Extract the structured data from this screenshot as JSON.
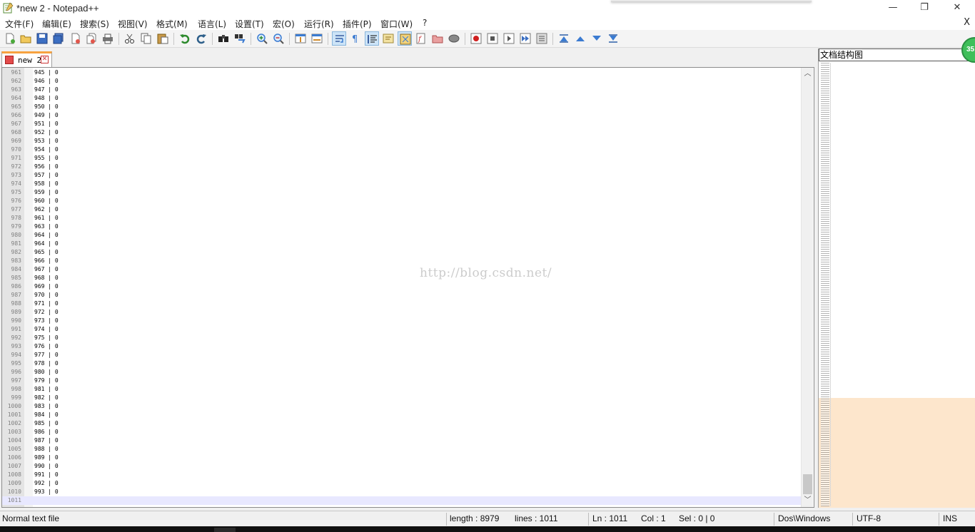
{
  "window": {
    "title": "*new 2 - Notepad++",
    "minimize_glyph": "—",
    "restore_glyph": "❐",
    "close_glyph": "✕"
  },
  "menu": {
    "items": [
      "文件(F)",
      "编辑(E)",
      "搜索(S)",
      "视图(V)",
      "格式(M)",
      "语言(L)",
      "设置(T)",
      "宏(O)",
      "运行(R)",
      "插件(P)",
      "窗口(W)",
      "?"
    ],
    "close_label": "X"
  },
  "toolbar": {
    "icons": [
      "new-file-icon",
      "open-file-icon",
      "save-icon",
      "save-all-icon",
      "close-icon",
      "close-all-icon",
      "print-icon",
      "cut-icon",
      "copy-icon",
      "paste-icon",
      "undo-icon",
      "redo-icon",
      "find-icon",
      "replace-icon",
      "zoom-in-icon",
      "zoom-out-icon",
      "sync-vertical-icon",
      "sync-horizontal-icon",
      "word-wrap-icon",
      "show-all-chars-icon",
      "indent-guide-icon",
      "user-language-icon",
      "document-map-icon",
      "function-list-icon",
      "folder-workspace-icon",
      "monitoring-icon",
      "record-macro-icon",
      "stop-macro-icon",
      "play-macro-icon",
      "run-macro-multiple-icon",
      "save-macro-icon",
      "first-icon",
      "previous-icon",
      "next-icon",
      "last-icon"
    ],
    "active": [
      "word-wrap-icon",
      "indent-guide-icon",
      "document-map-icon"
    ]
  },
  "tab": {
    "label": "new 2",
    "close_glyph": "✕"
  },
  "editor": {
    "lines": [
      {
        "n": "961",
        "text": "945 | 0"
      },
      {
        "n": "962",
        "text": "946 | 0"
      },
      {
        "n": "963",
        "text": "947 | 0"
      },
      {
        "n": "964",
        "text": "948 | 0"
      },
      {
        "n": "965",
        "text": "950 | 0"
      },
      {
        "n": "966",
        "text": "949 | 0"
      },
      {
        "n": "967",
        "text": "951 | 0"
      },
      {
        "n": "968",
        "text": "952 | 0"
      },
      {
        "n": "969",
        "text": "953 | 0"
      },
      {
        "n": "970",
        "text": "954 | 0"
      },
      {
        "n": "971",
        "text": "955 | 0"
      },
      {
        "n": "972",
        "text": "956 | 0"
      },
      {
        "n": "973",
        "text": "957 | 0"
      },
      {
        "n": "974",
        "text": "958 | 0"
      },
      {
        "n": "975",
        "text": "959 | 0"
      },
      {
        "n": "976",
        "text": "960 | 0"
      },
      {
        "n": "977",
        "text": "962 | 0"
      },
      {
        "n": "978",
        "text": "961 | 0"
      },
      {
        "n": "979",
        "text": "963 | 0"
      },
      {
        "n": "980",
        "text": "964 | 0"
      },
      {
        "n": "981",
        "text": "964 | 0"
      },
      {
        "n": "982",
        "text": "965 | 0"
      },
      {
        "n": "983",
        "text": "966 | 0"
      },
      {
        "n": "984",
        "text": "967 | 0"
      },
      {
        "n": "985",
        "text": "968 | 0"
      },
      {
        "n": "986",
        "text": "969 | 0"
      },
      {
        "n": "987",
        "text": "970 | 0"
      },
      {
        "n": "988",
        "text": "971 | 0"
      },
      {
        "n": "989",
        "text": "972 | 0"
      },
      {
        "n": "990",
        "text": "973 | 0"
      },
      {
        "n": "991",
        "text": "974 | 0"
      },
      {
        "n": "992",
        "text": "975 | 0"
      },
      {
        "n": "993",
        "text": "976 | 0"
      },
      {
        "n": "994",
        "text": "977 | 0"
      },
      {
        "n": "995",
        "text": "978 | 0"
      },
      {
        "n": "996",
        "text": "980 | 0"
      },
      {
        "n": "997",
        "text": "979 | 0"
      },
      {
        "n": "998",
        "text": "981 | 0"
      },
      {
        "n": "999",
        "text": "982 | 0"
      },
      {
        "n": "1000",
        "text": "983 | 0"
      },
      {
        "n": "1001",
        "text": "984 | 0"
      },
      {
        "n": "1002",
        "text": "985 | 0"
      },
      {
        "n": "1003",
        "text": "986 | 0"
      },
      {
        "n": "1004",
        "text": "987 | 0"
      },
      {
        "n": "1005",
        "text": "988 | 0"
      },
      {
        "n": "1006",
        "text": "989 | 0"
      },
      {
        "n": "1007",
        "text": "990 | 0"
      },
      {
        "n": "1008",
        "text": "991 | 0"
      },
      {
        "n": "1009",
        "text": "992 | 0"
      },
      {
        "n": "1010",
        "text": "993 | 0"
      },
      {
        "n": "1011",
        "text": ""
      }
    ],
    "current_line": "1011",
    "watermark": "http://blog.csdn.net/",
    "scroll_up_glyph": "︿",
    "scroll_down_glyph": "﹀"
  },
  "doc_map": {
    "title": "文档结构图",
    "badge": "35"
  },
  "status": {
    "file_type": "Normal text file",
    "length": "length : 8979",
    "lines": "lines : 1011",
    "ln": "Ln : 1011",
    "col": "Col : 1",
    "sel": "Sel : 0 | 0",
    "eol": "Dos\\Windows",
    "encoding": "UTF-8",
    "mode": "INS"
  },
  "colors": {
    "tab_accent": "#f7a240",
    "current_line": "#e8e8ff",
    "map_viewport": "#fde6cc",
    "badge": "#3fbf5a"
  }
}
